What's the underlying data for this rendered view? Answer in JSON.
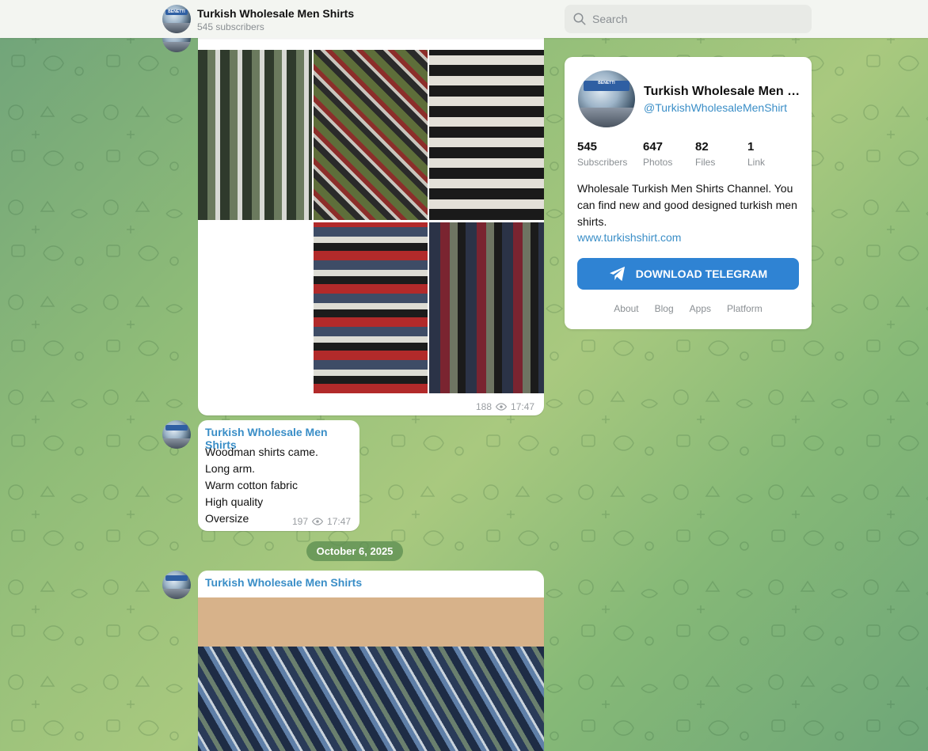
{
  "channel": {
    "title": "Turkish Wholesale Men Shirts",
    "subscribers_line": "545 subscribers",
    "avatar_text": "BENETTI"
  },
  "search": {
    "placeholder": "Search"
  },
  "messages": [
    {
      "views": "188",
      "time": "17:47"
    },
    {
      "author": "Turkish Wholesale Men Shirts",
      "lines": [
        "Woodman shirts came.",
        "Long arm.",
        "Warm cotton fabric",
        "High quality",
        "Oversize"
      ],
      "views": "197",
      "time": "17:47"
    },
    {
      "author": "Turkish Wholesale Men Shirts"
    }
  ],
  "date_separator": "October 6, 2025",
  "card": {
    "name": "Turkish Wholesale Men Shirts",
    "handle": "@TurkishWholesaleMenShirt",
    "stats": [
      {
        "num": "545",
        "label": "Subscribers"
      },
      {
        "num": "647",
        "label": "Photos"
      },
      {
        "num": "82",
        "label": "Files"
      },
      {
        "num": "1",
        "label": "Link"
      }
    ],
    "description": "Wholesale Turkish Men Shirts Channel. You can find new and good designed turkish men shirts.",
    "link": "www.turkishshirt.com",
    "download_label": "DOWNLOAD TELEGRAM",
    "footer": [
      "About",
      "Blog",
      "Apps",
      "Platform"
    ]
  },
  "colors": {
    "accent": "#3a8ec7",
    "button": "#2f83d3"
  }
}
